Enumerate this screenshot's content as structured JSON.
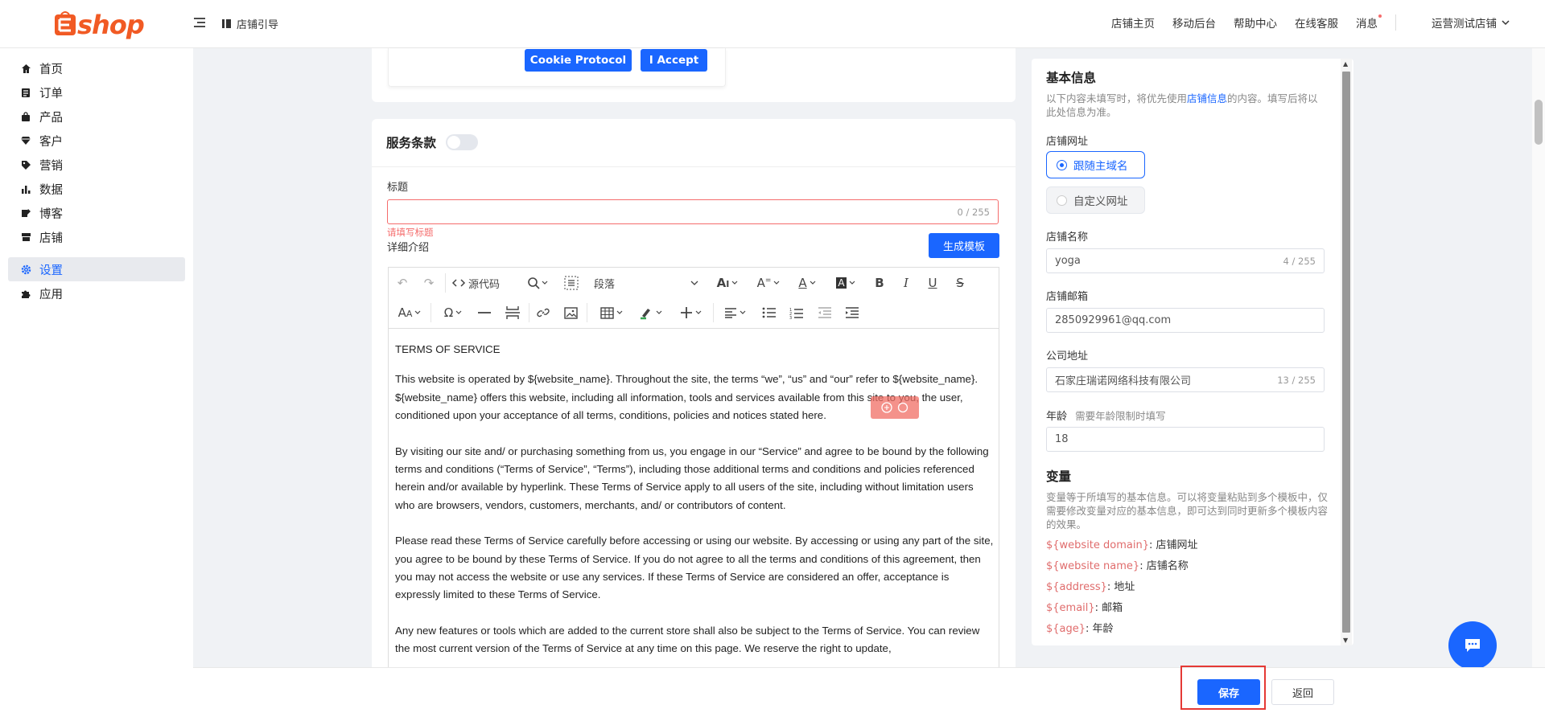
{
  "header": {
    "logo": "ecshop",
    "guide_label": "店铺引导",
    "nav": [
      "店铺主页",
      "移动后台",
      "帮助中心",
      "在线客服",
      "消息"
    ],
    "store_name": "运营测试店铺"
  },
  "sidebar": {
    "items": [
      {
        "label": "首页",
        "icon": "home-icon"
      },
      {
        "label": "订单",
        "icon": "order-icon"
      },
      {
        "label": "产品",
        "icon": "bag-icon"
      },
      {
        "label": "客户",
        "icon": "diamond-icon"
      },
      {
        "label": "营销",
        "icon": "tag-icon"
      },
      {
        "label": "数据",
        "icon": "chart-icon"
      },
      {
        "label": "博客",
        "icon": "blog-icon"
      },
      {
        "label": "店铺",
        "icon": "store-icon"
      },
      {
        "label": "设置",
        "icon": "gear-icon"
      },
      {
        "label": "应用",
        "icon": "puzzle-icon"
      }
    ],
    "active_index": 8
  },
  "cookie": {
    "protocol_button": "Cookie Protocol",
    "accept_button": "I Accept"
  },
  "terms": {
    "section_title": "服务条款",
    "title_label": "标题",
    "title_value": "",
    "title_counter": "0 / 255",
    "title_error": "请填写标题",
    "detail_label": "详细介绍",
    "generate_button": "生成模板",
    "toolbar": {
      "source_code": "源代码",
      "paragraph": "段落"
    },
    "content": [
      "TERMS OF SERVICE",
      "This website is operated by ${website_name}. Throughout the site, the terms “we”, “us” and “our” refer to ${website_name}. ${website_name} offers this website, including all information, tools and services available from this site to you, the user, conditioned upon your acceptance of all terms, conditions, policies and notices stated here.",
      "By visiting our site and/ or purchasing something from us, you engage in our “Service” and agree to be bound by the following terms and conditions (“Terms of Service”, “Terms”), including those additional terms and conditions and policies referenced herein and/or available by hyperlink. These Terms of Service apply to all users of the site, including without limitation users who are browsers, vendors, customers, merchants, and/ or contributors of content.",
      "Please read these Terms of Service carefully before accessing or using our website. By accessing or using any part of the site, you agree to be bound by these Terms of Service. If you do not agree to all the terms and conditions of this agreement, then you may not access the website or use any services. If these Terms of Service are considered an offer, acceptance is expressly limited to these Terms of Service.",
      "Any new features or tools which are added to the current store shall also be subject to the Terms of Service. You can review the most current version of the Terms of Service at any time on this page. We reserve the right to update,"
    ]
  },
  "basic_info": {
    "title": "基本信息",
    "desc_prefix": "以下内容未填写时，将优先使用",
    "desc_link": "店铺信息",
    "desc_suffix": "的内容。填写后将以此处信息为准。",
    "url_label": "店铺网址",
    "url_options": [
      "跟随主域名",
      "自定义网址"
    ],
    "url_selected": 0,
    "name_label": "店铺名称",
    "name_value": "yoga",
    "name_counter": "4 / 255",
    "email_label": "店铺邮箱",
    "email_value": "2850929961@qq.com",
    "address_label": "公司地址",
    "address_value": "石家庄瑞诺网络科技有限公司",
    "address_counter": "13 / 255",
    "age_label": "年龄",
    "age_hint": "需要年龄限制时填写",
    "age_value": "18"
  },
  "variables": {
    "title": "变量",
    "desc": "变量等于所填写的基本信息。可以将变量粘贴到多个模板中，仅需要修改变量对应的基本信息，即可达到同时更新多个模板内容的效果。",
    "items": [
      {
        "key": "${website domain}",
        "value": ": 店铺网址"
      },
      {
        "key": "${website name}",
        "value": ": 店铺名称"
      },
      {
        "key": "${address}",
        "value": ": 地址"
      },
      {
        "key": "${email}",
        "value": ": 邮箱"
      },
      {
        "key": "${age}",
        "value": ": 年龄"
      }
    ]
  },
  "footer": {
    "save_button": "保存",
    "back_button": "返回"
  },
  "colors": {
    "primary": "#1a66ff",
    "error": "#f56c6c",
    "logo": "#f15a24",
    "highlight_box": "#e53935"
  }
}
